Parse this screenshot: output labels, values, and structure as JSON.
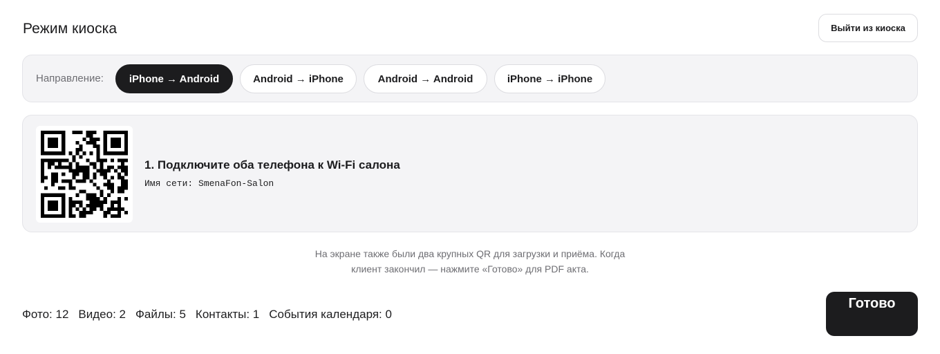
{
  "header": {
    "title": "Режим киоска",
    "exit_label": "Выйти из киоска"
  },
  "direction": {
    "label": "Направление:",
    "options": [
      {
        "label": "iPhone → Android",
        "active": true
      },
      {
        "label": "Android → iPhone",
        "active": false
      },
      {
        "label": "Android → Android",
        "active": false
      },
      {
        "label": "iPhone → iPhone",
        "active": false
      }
    ]
  },
  "step": {
    "title": "1. Подключите оба телефона к Wi-Fi салона",
    "network_line": "Имя сети: SmenaFon-Salon",
    "icon": "qr-code-icon"
  },
  "note": {
    "line1": "На экране также были два крупных QR для загрузки и приёма. Когда",
    "line2": "клиент закончил — нажмите «Готово» для PDF акта."
  },
  "stats": {
    "photos": "Фото: 12",
    "videos": "Видео: 2",
    "files": "Файлы: 5",
    "contacts": "Контакты: 1",
    "calendar": "События календаря: 0"
  },
  "done_label": "Готово",
  "colors": {
    "accent_dark": "#1c1c1e",
    "panel_bg": "#f4f4f6",
    "muted_text": "#6e6e73"
  }
}
